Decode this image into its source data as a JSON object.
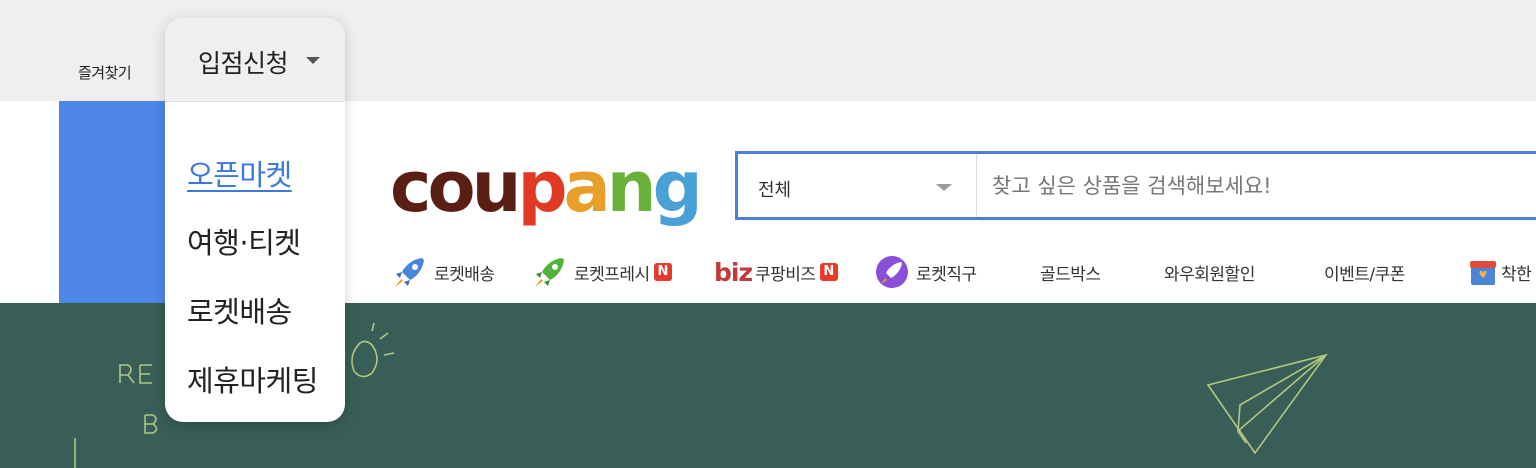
{
  "topbar": {
    "favorites_label": "즐겨찾기"
  },
  "dropdown": {
    "title": "입점신청",
    "items": [
      {
        "label": "오픈마켓",
        "active": true
      },
      {
        "label": "여행·티켓"
      },
      {
        "label": "로켓배송"
      },
      {
        "label": "제휴마케팅"
      }
    ]
  },
  "logo": {
    "letters": [
      "c",
      "o",
      "u",
      "p",
      "a",
      "n",
      "g"
    ],
    "colors": [
      "#5a1f14",
      "#5a1f14",
      "#5a1f14",
      "#e03a24",
      "#e6a028",
      "#6ab03a",
      "#4aa1d6"
    ]
  },
  "search": {
    "category": "전체",
    "placeholder": "찾고 싶은 상품을 검색해보세요!"
  },
  "nav": {
    "items": [
      {
        "label": "로켓배송",
        "icon": "rocket-icon"
      },
      {
        "label": "로켓프레시",
        "icon": "green-rocket-icon",
        "badge": "N"
      },
      {
        "label": "쿠팡비즈",
        "prefix": "biz",
        "badge": "N"
      },
      {
        "label": "로켓직구",
        "icon": "purple-rocket-icon"
      },
      {
        "label": "골드박스"
      },
      {
        "label": "와우회원할인"
      },
      {
        "label": "이벤트/쿠폰"
      },
      {
        "label": "착한",
        "icon": "shop-icon"
      }
    ]
  },
  "banner": {
    "color": "#385e57"
  }
}
